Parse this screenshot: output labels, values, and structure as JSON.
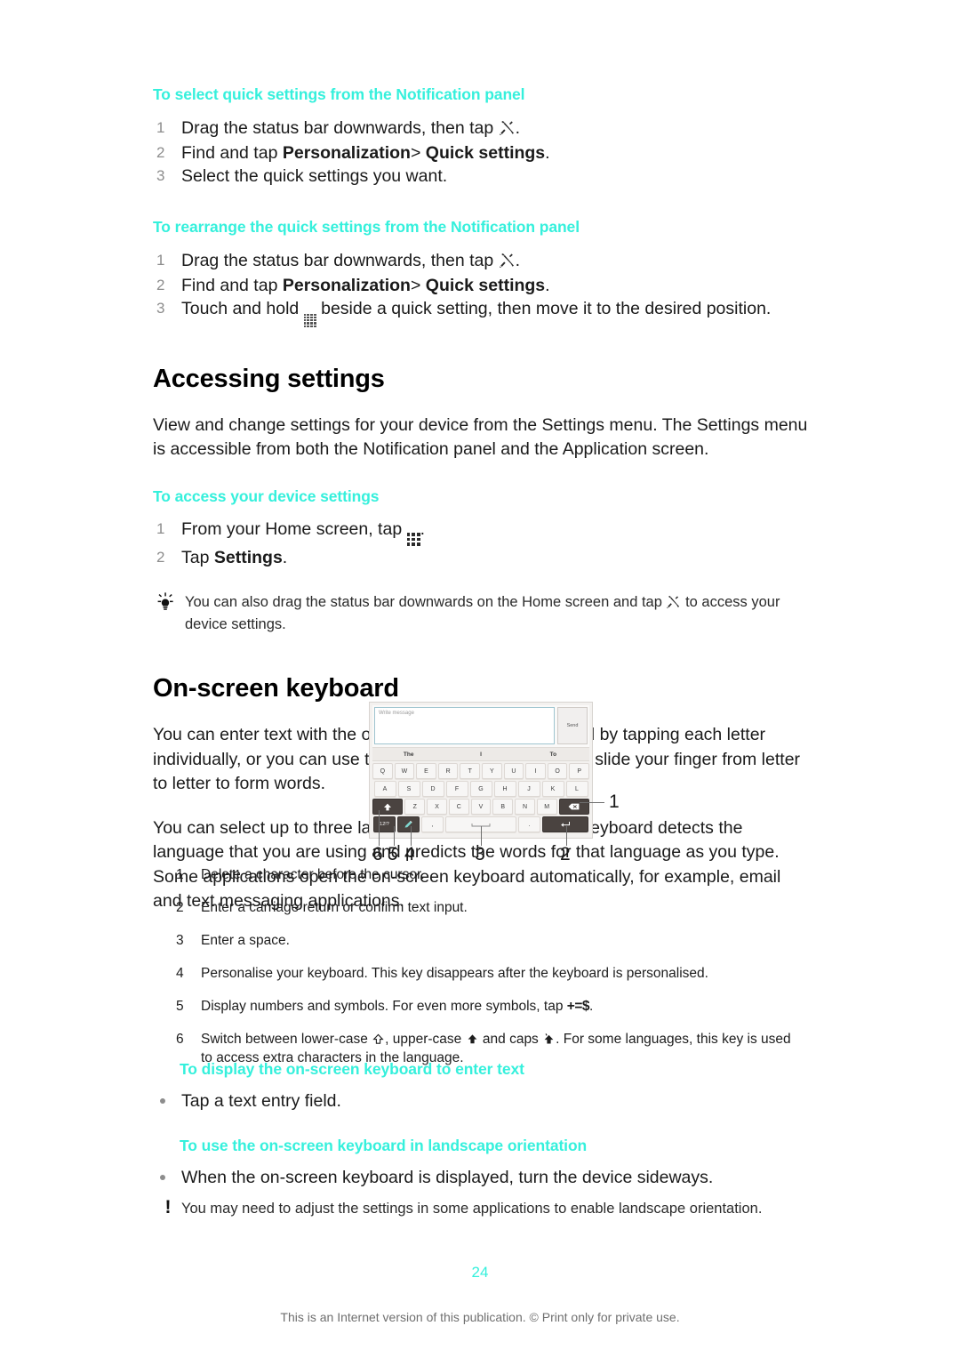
{
  "sections": [
    {
      "heading": "To select quick settings from the Notification panel",
      "steps": [
        {
          "num": "1",
          "pre": "Drag the status bar downwards, then tap ",
          "icon": "settings-wrench-icon",
          "post": "."
        },
        {
          "num": "2",
          "pre": "Find and tap ",
          "bold1": "Personalization",
          "mid": "> ",
          "bold2": "Quick settings",
          "post": "."
        },
        {
          "num": "3",
          "pre": "Select the quick settings you want."
        }
      ]
    },
    {
      "heading": "To rearrange the quick settings from the Notification panel",
      "steps": [
        {
          "num": "1",
          "pre": "Drag the status bar downwards, then tap ",
          "icon": "settings-wrench-icon",
          "post": "."
        },
        {
          "num": "2",
          "pre": "Find and tap ",
          "bold1": "Personalization",
          "mid": "> ",
          "bold2": "Quick settings",
          "post": "."
        },
        {
          "num": "3",
          "pre": "Touch and hold ",
          "icon": "drag-handle-icon",
          "post": " beside a quick setting, then move it to the desired position."
        }
      ]
    }
  ],
  "accessing_settings": {
    "title": "Accessing settings",
    "paragraph": "View and change settings for your device from the Settings menu. The Settings menu is accessible from both the Notification panel and the Application screen.",
    "sub_heading": "To access your device settings",
    "steps": [
      {
        "num": "1",
        "pre": "From your Home screen, tap ",
        "icon": "app-grid-icon",
        "post": "."
      },
      {
        "num": "2",
        "pre": "Tap ",
        "bold1": "Settings",
        "post": "."
      }
    ],
    "tip": {
      "icon": "lightbulb-tip-icon",
      "pre": "You can also drag the status bar downwards on the Home screen and tap ",
      "inline_icon": "settings-wrench-icon",
      "post": " to access your device settings."
    }
  },
  "onscreen_keyboard": {
    "title": "On-screen keyboard",
    "paragraph_1": "You can enter text with the on-screen QWERTY keyboard by tapping each letter individually, or you can use the Gesture input feature and slide your finger from letter to letter to form words.",
    "paragraph_2": "You can select up to three languages for text input. The keyboard detects the language that you are using and predicts the words for that language as you type. Some applications open the on-screen keyboard automatically, for example, email and text messaging applications.",
    "figure": {
      "compose_placeholder": "Write message",
      "send_label": "Send",
      "suggestions": [
        "The",
        "I",
        "To"
      ],
      "row_1": [
        "Q",
        "W",
        "E",
        "R",
        "T",
        "Y",
        "U",
        "I",
        "O",
        "P"
      ],
      "row_2": [
        "A",
        "S",
        "D",
        "F",
        "G",
        "H",
        "J",
        "K",
        "L"
      ],
      "row_3": [
        "Z",
        "X",
        "C",
        "V",
        "B",
        "N",
        "M"
      ],
      "shift_key": "shift-icon",
      "backspace_key": "backspace-icon",
      "numeric_key": "12!?",
      "personalise_key": "personalise-icon",
      "comma_key": ",",
      "space_key": "space-icon",
      "period_key": ".",
      "enter_key": "enter-icon",
      "callout_numbers": [
        "1",
        "2",
        "3",
        "4",
        "5",
        "6"
      ]
    },
    "legend": [
      {
        "num": "1",
        "text": "Delete a character before the cursor."
      },
      {
        "num": "2",
        "text": "Enter a carriage return or confirm text input."
      },
      {
        "num": "3",
        "text": "Enter a space."
      },
      {
        "num": "4",
        "text": "Personalise your keyboard. This key disappears after the keyboard is personalised."
      },
      {
        "num": "5",
        "pre": "Display numbers and symbols. For even more symbols, tap ",
        "symbol": "+=$",
        "post": "."
      },
      {
        "num": "6",
        "pre": "Switch between lower-case ",
        "mid1": ", upper-case ",
        "mid2": " and caps ",
        "post": ". For some languages, this key is used to access extra characters in the language."
      }
    ],
    "display_heading": "To display the on-screen keyboard to enter text",
    "display_bullet": "Tap a text entry field.",
    "landscape_heading": "To use the on-screen keyboard in landscape orientation",
    "landscape_bullet": "When the on-screen keyboard is displayed, turn the device sideways.",
    "landscape_note": {
      "icon": "exclamation-note-icon",
      "text": "You may need to adjust the settings in some applications to enable landscape orientation."
    }
  },
  "footer": {
    "page_number": "24",
    "note": "This is an Internet version of this publication. © Print only for private use."
  },
  "colors": {
    "accent": "#35f0dc",
    "body_text": "#1a1a1a",
    "step_number": "#8d8d8d",
    "footer_text": "#6f6f6f"
  }
}
